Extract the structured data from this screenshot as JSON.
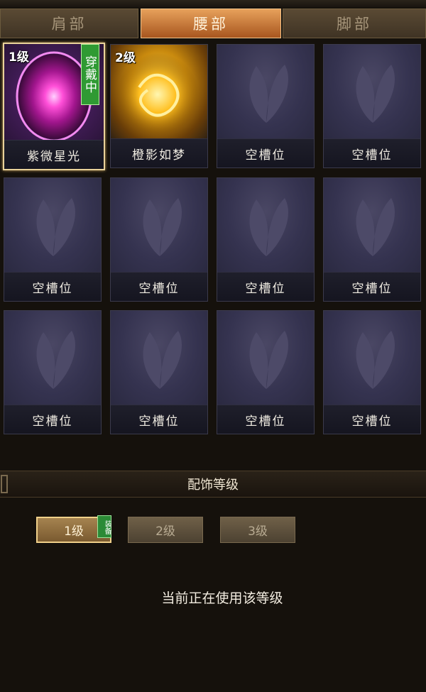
{
  "tabs": [
    {
      "label": "肩部",
      "active": false
    },
    {
      "label": "腰部",
      "active": true
    },
    {
      "label": "脚部",
      "active": false
    }
  ],
  "slots": [
    {
      "name": "紫微星光",
      "level": "1级",
      "wearing_label": "穿戴中",
      "art": "purple-orb"
    },
    {
      "name": "橙影如梦",
      "level": "2级",
      "art": "gold-flame"
    },
    {
      "name": "空槽位"
    },
    {
      "name": "空槽位"
    },
    {
      "name": "空槽位"
    },
    {
      "name": "空槽位"
    },
    {
      "name": "空槽位"
    },
    {
      "name": "空槽位"
    },
    {
      "name": "空槽位"
    },
    {
      "name": "空槽位"
    },
    {
      "name": "空槽位"
    },
    {
      "name": "空槽位"
    }
  ],
  "section": {
    "title": "配饰等级"
  },
  "levels": [
    {
      "label": "1级",
      "active": true,
      "tag": "装备"
    },
    {
      "label": "2级",
      "active": false
    },
    {
      "label": "3级",
      "active": false
    }
  ],
  "status_text": "当前正在使用该等级",
  "icons": {
    "empty_slot": "butterfly-icon",
    "item1": "purple-orb-icon",
    "item2": "gold-flame-icon"
  },
  "colors": {
    "active_tab": "#c97a38",
    "wearing_badge": "#2f9a33",
    "selected_border": "#e9d29a"
  }
}
